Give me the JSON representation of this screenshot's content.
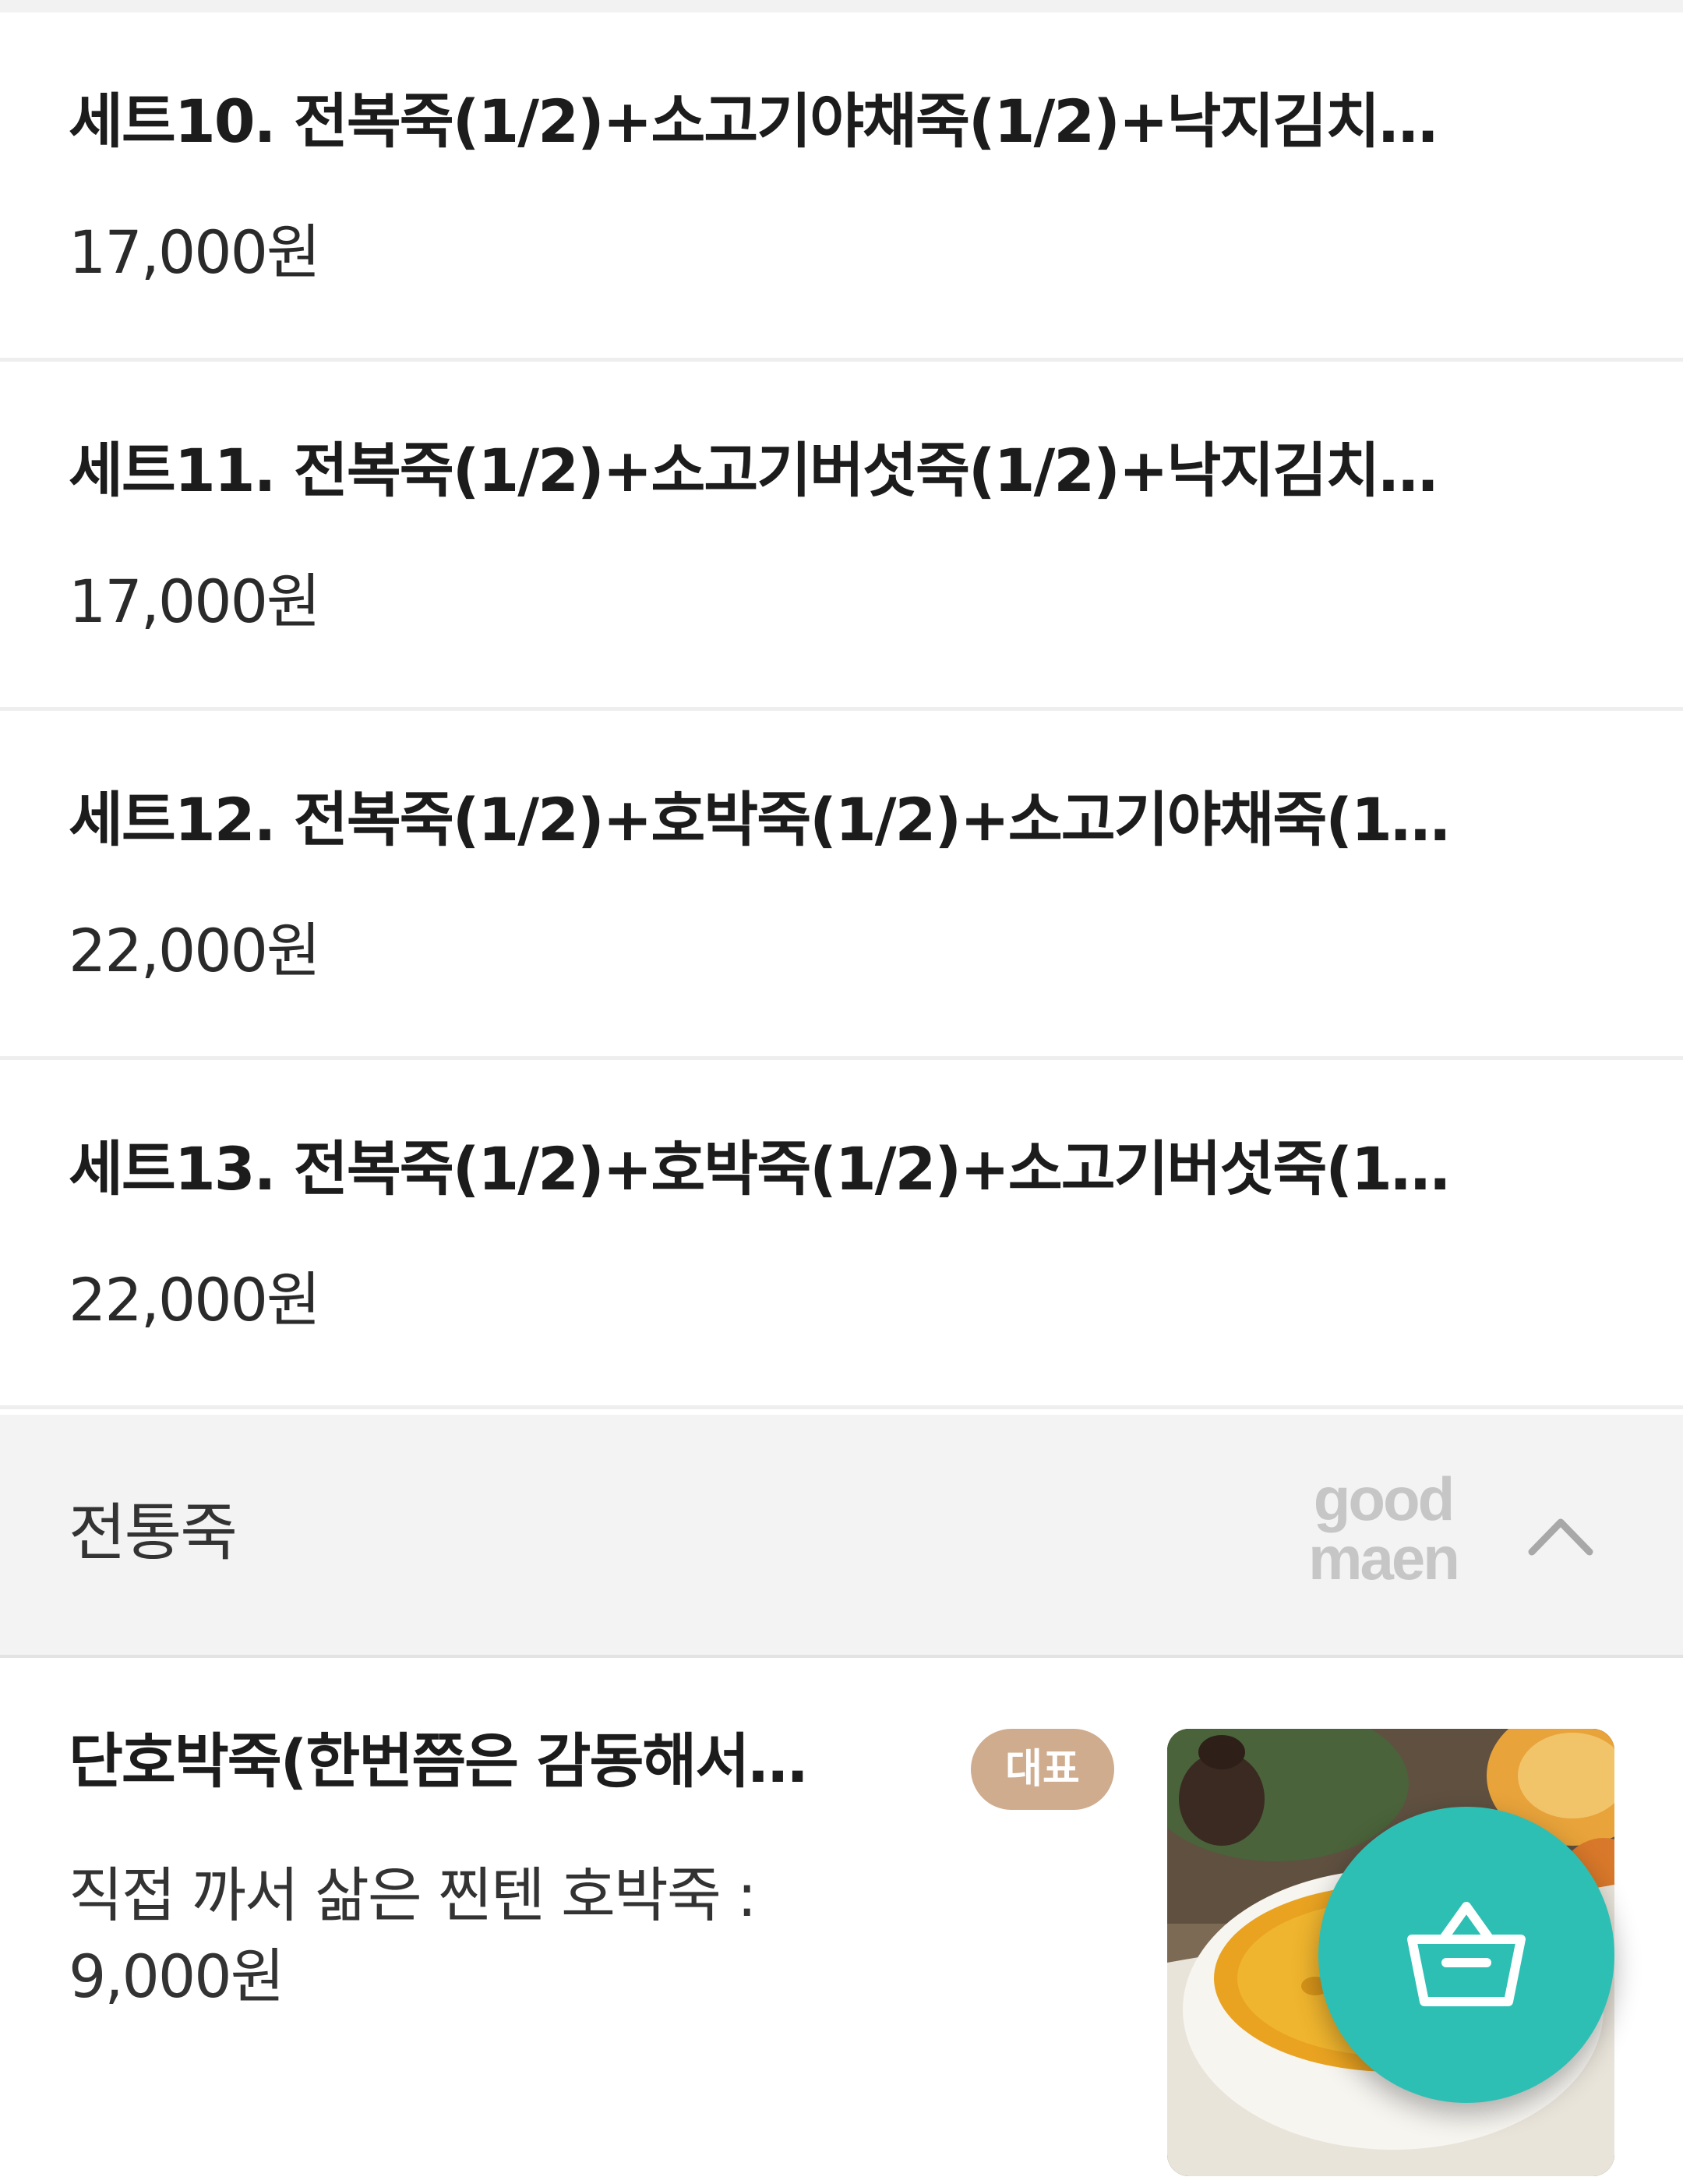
{
  "menu_items": [
    {
      "title": "세트10. 전복죽(1/2)+소고기야채죽(1/2)+낙지김치…",
      "price": "17,000원"
    },
    {
      "title": "세트11. 전복죽(1/2)+소고기버섯죽(1/2)+낙지김치…",
      "price": "17,000원"
    },
    {
      "title": "세트12. 전복죽(1/2)+호박죽(1/2)+소고기야채죽(1…",
      "price": "22,000원"
    },
    {
      "title": "세트13. 전복죽(1/2)+호박죽(1/2)+소고기버섯죽(1…",
      "price": "22,000원"
    }
  ],
  "category": {
    "title": "전통죽",
    "watermark_line1": "good",
    "watermark_line2": "maen",
    "toggle_icon": "chevron-up-icon"
  },
  "featured": {
    "title": "단호박죽(한번쯤은 감동해서…",
    "badge": "대표",
    "description": "직접 까서 삶은 찐텐 호박죽 : 9,000원",
    "image_icon": "pumpkin-porridge-photo"
  },
  "cart_button": {
    "icon": "shopping-basket-icon",
    "color": "#2ebfb4"
  },
  "colors": {
    "badge_bg": "#cfac8d",
    "category_bg": "#f3f3f3",
    "accent": "#2ebfb4"
  }
}
